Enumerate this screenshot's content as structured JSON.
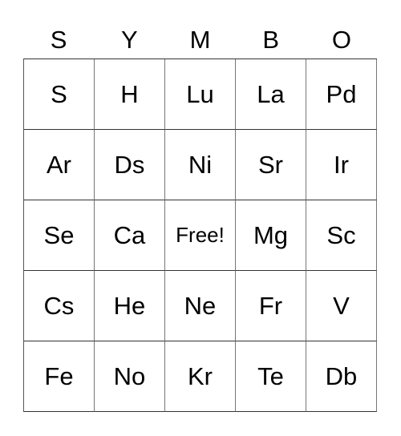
{
  "header": [
    "S",
    "Y",
    "M",
    "B",
    "O"
  ],
  "board": [
    [
      "S",
      "H",
      "Lu",
      "La",
      "Pd"
    ],
    [
      "Ar",
      "Ds",
      "Ni",
      "Sr",
      "Ir"
    ],
    [
      "Se",
      "Ca",
      "Free!",
      "Mg",
      "Sc"
    ],
    [
      "Cs",
      "He",
      "Ne",
      "Fr",
      "V"
    ],
    [
      "Fe",
      "No",
      "Kr",
      "Te",
      "Db"
    ]
  ]
}
